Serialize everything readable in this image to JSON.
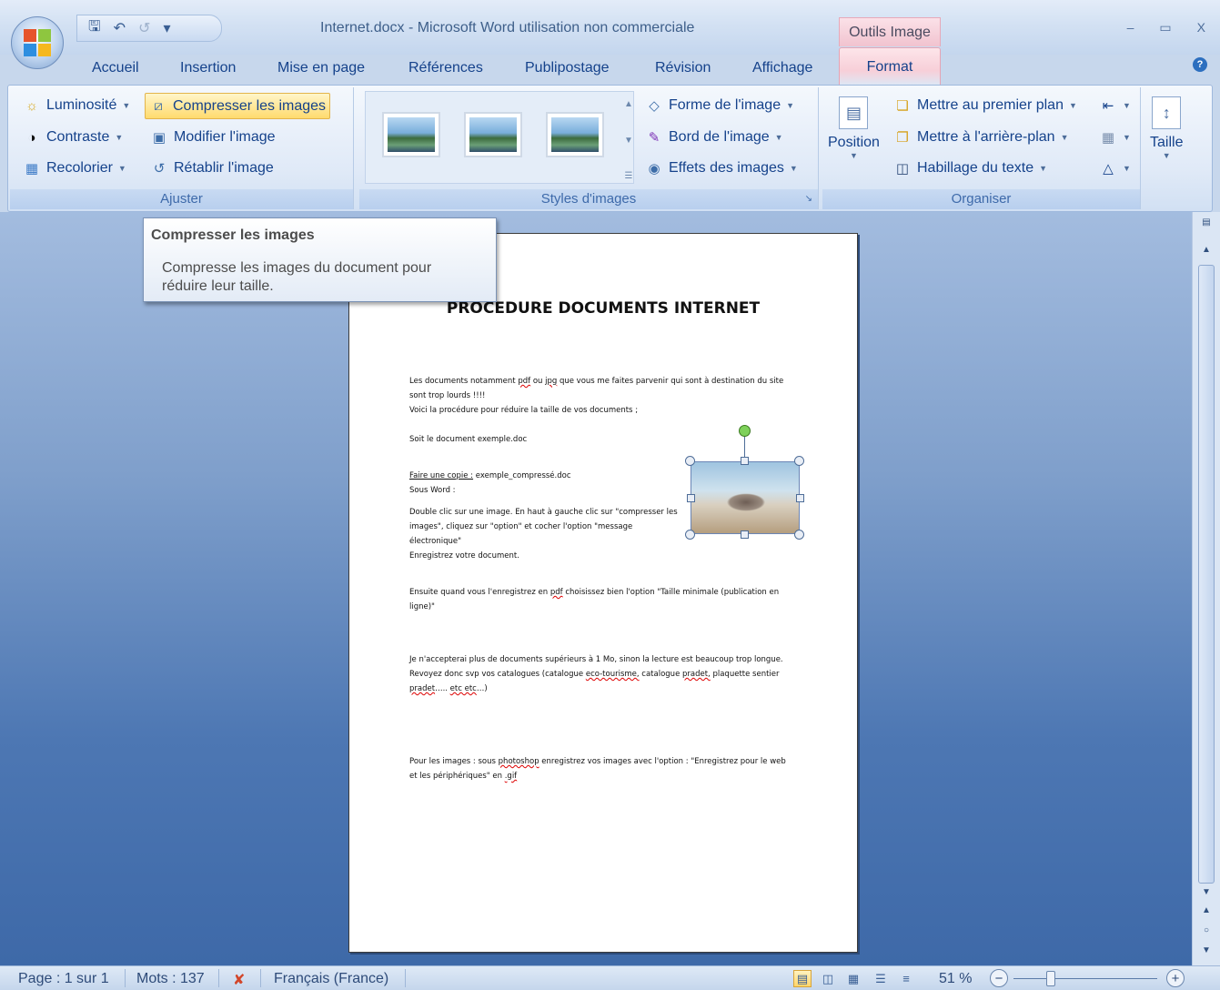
{
  "window": {
    "title": "Internet.docx - Microsoft Word utilisation non commerciale",
    "contextual_header": "Outils Image",
    "controls": [
      "–",
      "▭",
      "X"
    ]
  },
  "quick_access": {
    "save_icon": "save-icon",
    "undo_icon": "undo-icon",
    "redo_icon": "redo-icon"
  },
  "tabs": [
    "Accueil",
    "Insertion",
    "Mise en page",
    "Références",
    "Publipostage",
    "Révision",
    "Affichage",
    "Format"
  ],
  "ribbon": {
    "ajuster": {
      "label": "Ajuster",
      "buttons": {
        "luminosite": "Luminosité",
        "contraste": "Contraste",
        "recolorier": "Recolorier",
        "compresser": "Compresser les images",
        "modifier": "Modifier l'image",
        "retablir": "Rétablir l'image"
      }
    },
    "styles": {
      "label": "Styles d'images",
      "buttons": {
        "forme": "Forme de l'image",
        "bord": "Bord de l'image",
        "effets": "Effets des images"
      }
    },
    "organiser": {
      "label": "Organiser",
      "position": "Position",
      "buttons": {
        "premier_plan": "Mettre au premier plan",
        "arriere_plan": "Mettre à l'arrière-plan",
        "habillage": "Habillage du texte"
      }
    },
    "taille": {
      "label": "Taille"
    }
  },
  "tooltip": {
    "title": "Compresser les images",
    "body": "Compresse les images du document pour réduire leur taille."
  },
  "document": {
    "heading": "PROCEDURE DOCUMENTS INTERNET",
    "p1a": "Les documents notamment",
    "p1b": "pdf",
    "p1c": "ou",
    "p1d": "jpg",
    "p1e": "que vous me faites parvenir qui sont à destination du site sont trop lourds !!!!",
    "p2": "Voici la procédure pour réduire la taille de vos documents ;",
    "p3": "Soit le document exemple.doc",
    "p4a": "Faire une copie :",
    "p4b": "exemple_compressé.doc",
    "p5": "Sous Word :",
    "p6": "Double clic sur une image. En haut à gauche clic sur \"compresser les images\", cliquez sur \"option\" et cocher l'option \"message électronique\"",
    "p7": "Enregistrez votre document.",
    "p8a": "Ensuite quand vous l'enregistrez en",
    "p8b": "pdf",
    "p8c": "choisissez bien l'option \"Taille minimale (publication en ligne)\"",
    "p9a": "Je n'accepterai plus de documents supérieurs à 1 Mo, sinon la lecture est beaucoup trop longue. Revoyez donc svp vos catalogues (catalogue",
    "p9b": "eco-tourisme,",
    "p9c": "catalogue",
    "p9d": "pradet,",
    "p9e": "plaquette sentier",
    "p9f": "pradet",
    "p9g": "…..",
    "p9h": "etc etc",
    "p9i": "…)",
    "p10a": "Pour les images : sous",
    "p10b": "photoshop",
    "p10c": "enregistrez vos images avec l'option : \"Enregistrez pour le web et les périphériques\" en",
    "p10d": ".gif"
  },
  "status": {
    "page": "Page : 1 sur 1",
    "words": "Mots : 137",
    "language": "Français (France)",
    "zoom": "51 %"
  },
  "colors": {
    "format_tab": "#f7cfd8",
    "workspace": "#4d77b3",
    "highlight": "#ffdb6e"
  }
}
